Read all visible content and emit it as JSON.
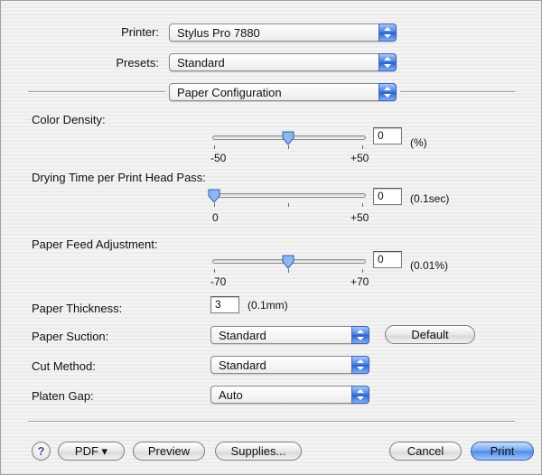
{
  "printer": {
    "label": "Printer:",
    "value": "Stylus Pro 7880"
  },
  "presets": {
    "label": "Presets:",
    "value": "Standard"
  },
  "panel": {
    "value": "Paper Configuration"
  },
  "color_density": {
    "label": "Color Density:",
    "value": "0",
    "unit": "(%)",
    "min_label": "-50",
    "max_label": "+50",
    "slider_fraction": 0.5
  },
  "drying_time": {
    "label": "Drying Time per Print Head Pass:",
    "value": "0",
    "unit": "(0.1sec)",
    "min_label": "0",
    "max_label": "+50",
    "slider_fraction": 0.0
  },
  "paper_feed": {
    "label": "Paper Feed Adjustment:",
    "value": "0",
    "unit": "(0.01%)",
    "min_label": "-70",
    "max_label": "+70",
    "slider_fraction": 0.5
  },
  "paper_thickness": {
    "label": "Paper Thickness:",
    "value": "3",
    "unit": "(0.1mm)"
  },
  "paper_suction": {
    "label": "Paper Suction:",
    "value": "Standard",
    "default_button": "Default"
  },
  "cut_method": {
    "label": "Cut Method:",
    "value": "Standard"
  },
  "platen_gap": {
    "label": "Platen Gap:",
    "value": "Auto"
  },
  "bottom": {
    "help": "?",
    "pdf": "PDF ▾",
    "preview": "Preview",
    "supplies": "Supplies...",
    "cancel": "Cancel",
    "print": "Print"
  },
  "colors": {
    "accent": "#4d89e9",
    "popup_arrow": "#2a5fcc"
  }
}
